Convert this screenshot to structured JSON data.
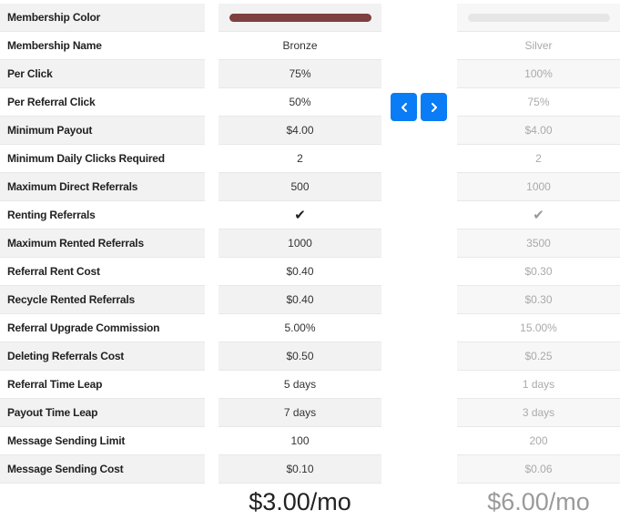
{
  "labels": [
    "Membership Color",
    "Membership Name",
    "Per Click",
    "Per Referral Click",
    "Minimum Payout",
    "Minimum Daily Clicks Required",
    "Maximum Direct Referrals",
    "Renting Referrals",
    "Maximum Rented Referrals",
    "Referral Rent Cost",
    "Recycle Rented Referrals",
    "Referral Upgrade Commission",
    "Deleting Referrals Cost",
    "Referral Time Leap",
    "Payout Time Leap",
    "Message Sending Limit",
    "Message Sending Cost"
  ],
  "plans": [
    {
      "color": "#7f3f3f",
      "name": "Bronze",
      "per_click": "75%",
      "per_referral_click": "50%",
      "minimum_payout": "$4.00",
      "minimum_daily_clicks": "2",
      "maximum_direct_referrals": "500",
      "renting_referrals": "check-icon",
      "maximum_rented_referrals": "1000",
      "referral_rent_cost": "$0.40",
      "recycle_rented_referrals": "$0.40",
      "referral_upgrade_commission": "5.00%",
      "deleting_referrals_cost": "$0.50",
      "referral_time_leap": "5 days",
      "payout_time_leap": "7 days",
      "message_sending_limit": "100",
      "message_sending_cost": "$0.10",
      "price": "$3.00/mo"
    },
    {
      "color": "#e6e6e6",
      "name": "Silver",
      "per_click": "100%",
      "per_referral_click": "75%",
      "minimum_payout": "$4.00",
      "minimum_daily_clicks": "2",
      "maximum_direct_referrals": "1000",
      "renting_referrals": "check-icon",
      "maximum_rented_referrals": "3500",
      "referral_rent_cost": "$0.30",
      "recycle_rented_referrals": "$0.30",
      "referral_upgrade_commission": "15.00%",
      "deleting_referrals_cost": "$0.25",
      "referral_time_leap": "1 days",
      "payout_time_leap": "3 days",
      "message_sending_limit": "200",
      "message_sending_cost": "$0.06",
      "price": "$6.00/mo"
    }
  ],
  "nav": {
    "prev_icon": "chevron-left-icon",
    "next_icon": "chevron-right-icon",
    "button_color": "#0a7cf5"
  },
  "check_glyph": "✔"
}
